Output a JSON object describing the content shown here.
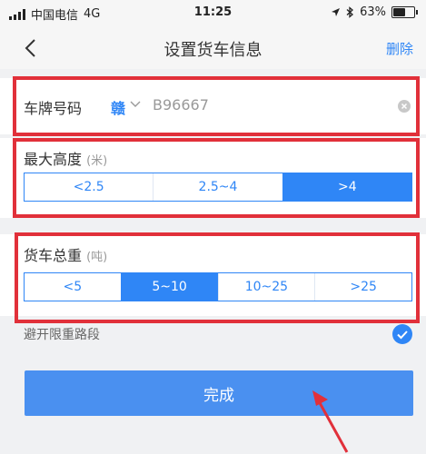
{
  "status": {
    "carrier": "中国电信",
    "network": "4G",
    "time": "11:25",
    "battery": "63%",
    "battery_level": 0.63
  },
  "nav": {
    "title": "设置货车信息",
    "delete_label": "删除"
  },
  "plate": {
    "label": "车牌号码",
    "province": "赣",
    "value": "B96667"
  },
  "height": {
    "title": "最大高度",
    "unit": "(米)",
    "options": [
      "<2.5",
      "2.5~4",
      ">4"
    ],
    "selected": ">4"
  },
  "weight": {
    "title": "货车总重",
    "unit": "(吨)",
    "options": [
      "<5",
      "5~10",
      "10~25",
      ">25"
    ],
    "selected": "5~10"
  },
  "avoid": {
    "label": "避开限重路段",
    "checked": true
  },
  "done": {
    "label": "完成"
  },
  "colors": {
    "accent": "#2f86f6",
    "highlight": "#e1303a",
    "button": "#4a90f0"
  }
}
